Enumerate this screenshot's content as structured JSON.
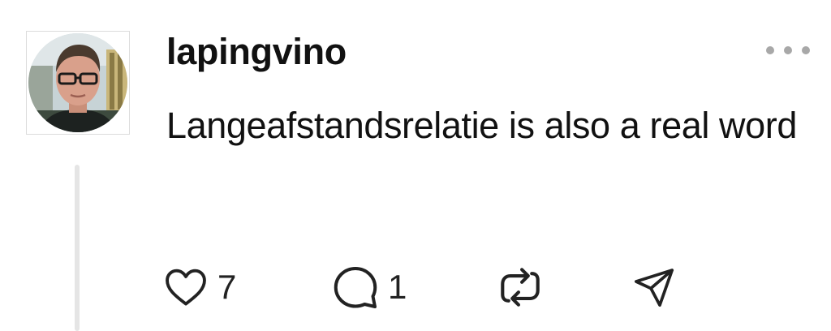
{
  "post": {
    "username": "lapingvino",
    "text": "Langeafstandsrelatie is also a real word",
    "avatar_icon": "person-photo-avatar",
    "more_icon": "more-horizontal-icon"
  },
  "actions": {
    "like": {
      "icon": "heart-icon",
      "count": "7"
    },
    "reply": {
      "icon": "comment-bubble-icon",
      "count": "1"
    },
    "repost": {
      "icon": "repost-icon"
    },
    "share": {
      "icon": "send-icon"
    }
  },
  "colors": {
    "text": "#111111",
    "muted": "#a8a8a8",
    "thread_line": "#e5e5e5"
  }
}
